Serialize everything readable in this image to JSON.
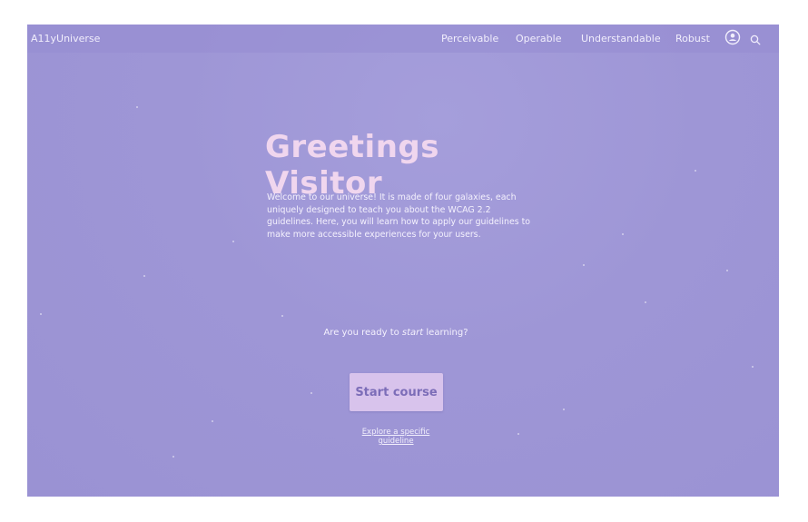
{
  "app": {
    "brand": "A11yUniverse"
  },
  "nav": {
    "items": [
      {
        "label": "Perceivable"
      },
      {
        "label": "Operable"
      },
      {
        "label": "Understandable"
      },
      {
        "label": "Robust"
      }
    ],
    "account_icon": "user-circle-icon",
    "search_icon": "search-icon"
  },
  "hero": {
    "title": "Greetings Visitor",
    "intro": "Welcome to our universe! It is made of four galaxies, each uniquely designed to teach you about the WCAG 2.2 guidelines. Here, you will learn how to apply our guidelines to make more accessible experiences for your users.",
    "question_prefix": "Are you ready to ",
    "question_emphasis": "start",
    "question_suffix": " learning?"
  },
  "actions": {
    "start_label": "Start course",
    "explore_label": "Explore a specific guideline"
  },
  "colors": {
    "background": "#9e96d6",
    "title": "#f0d6ee",
    "button": "#d8c3ec",
    "button_text": "#7c6db8"
  }
}
